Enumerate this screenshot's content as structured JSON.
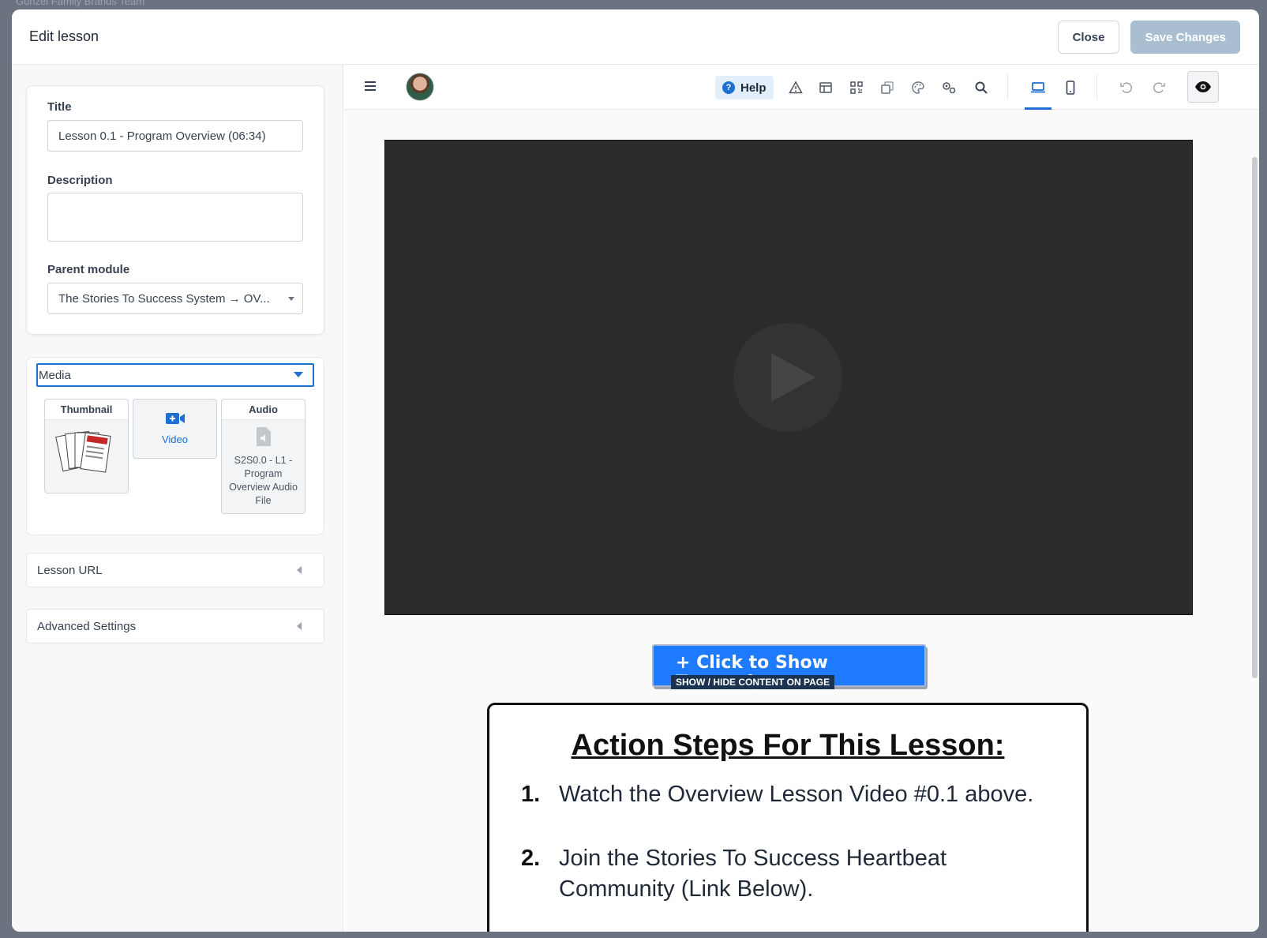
{
  "backdrop": {
    "workspace": "Gunzel Family Brands Team"
  },
  "modal": {
    "title": "Edit lesson",
    "close_label": "Close",
    "save_label": "Save Changes"
  },
  "form": {
    "title_label": "Title",
    "title_value": "Lesson 0.1 - Program Overview (06:34)",
    "description_label": "Description",
    "description_value": "",
    "parent_label": "Parent module",
    "parent_value": "The Stories To Success System → OV..."
  },
  "media": {
    "select_value": "Media",
    "tiles": {
      "thumbnail": "Thumbnail",
      "video": "Video",
      "audio": "Audio",
      "audio_file": "S2S0.0 - L1 - Program Overview Audio File"
    }
  },
  "sections": {
    "lesson_url": "Lesson URL",
    "advanced": "Advanced Settings"
  },
  "toolbar": {
    "help_label": "Help",
    "icons": [
      "menu-icon",
      "warning-icon",
      "layout-icon",
      "qr-code-icon",
      "layers-icon",
      "palette-icon",
      "settings-icon",
      "search-icon",
      "desktop-icon",
      "mobile-icon",
      "undo-icon",
      "redo-icon",
      "preview-eye-icon"
    ],
    "active_device": "desktop"
  },
  "content": {
    "transcript_button": "+ Click to Show Transcript",
    "transcript_sub": "SHOW / HIDE CONTENT ON PAGE",
    "action_title": "Action Steps For This Lesson:",
    "steps": [
      {
        "num": "1.",
        "text": "Watch the Overview Lesson Video #0.1 above."
      },
      {
        "num": "2.",
        "text": "Join the Stories To Success Heartbeat Community (Link Below)."
      }
    ]
  },
  "colors": {
    "accent": "#1d6fd1",
    "save_disabled": "#a9bfd1",
    "transcript_button": "#1e7bff"
  }
}
